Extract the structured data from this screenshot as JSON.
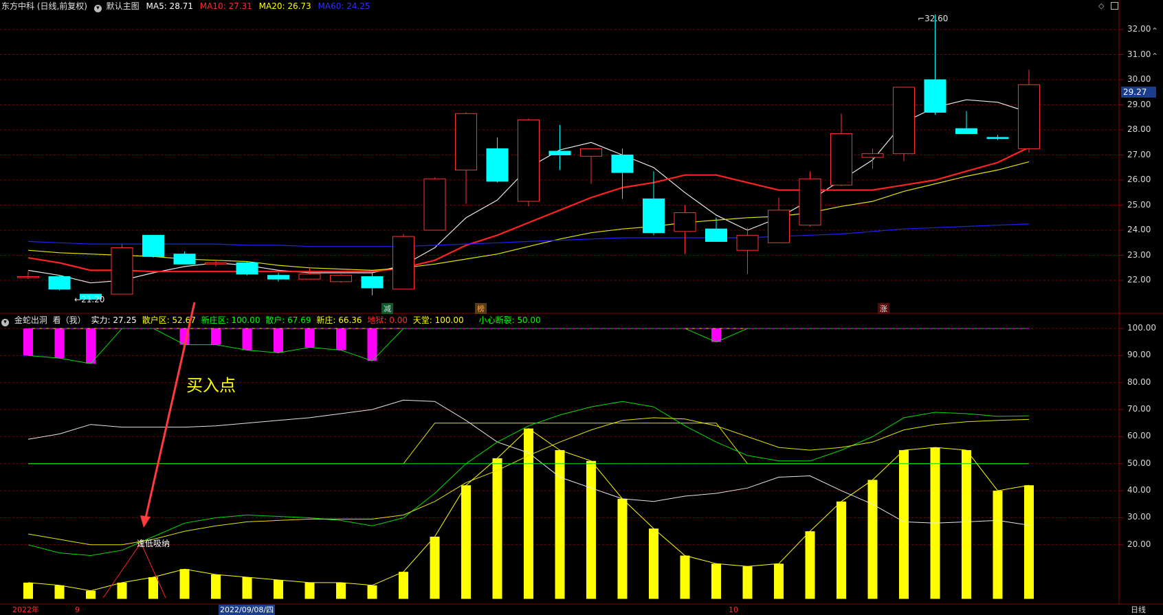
{
  "window": {
    "symbol_title": "东方中科 (日线,前复权)",
    "main_chart_label": "默认主图",
    "ma": [
      {
        "label": "MA5: 28.71",
        "color": "#ffffff"
      },
      {
        "label": "MA10: 27.31",
        "color": "#ff2b2b"
      },
      {
        "label": "MA20: 26.73",
        "color": "#ffff00"
      },
      {
        "label": "MA60: 24.25",
        "color": "#3030ff"
      }
    ]
  },
  "price_axis": {
    "labels": [
      "32.00",
      "31.00",
      "30.00",
      "29.00",
      "28.00",
      "27.00",
      "26.00",
      "25.00",
      "24.00",
      "23.00",
      "22.00"
    ],
    "current_price": "29.27",
    "high_label": "32.60",
    "low_label": "21.20"
  },
  "indicator": {
    "name": "金蛇出洞",
    "view_label": "看（我）",
    "legend": [
      {
        "label": "实力: 27.25",
        "color": "#ffffff"
      },
      {
        "label": "散户区: 52.67",
        "color": "#ffff00"
      },
      {
        "label": "新庄区: 100.00",
        "color": "#00ff00"
      },
      {
        "label": "散户: 67.69",
        "color": "#00ff00"
      },
      {
        "label": "新庄: 66.36",
        "color": "#ffff00"
      },
      {
        "label": "地狱: 0.00",
        "color": "#ff3030"
      },
      {
        "label": "天堂: 100.00",
        "color": "#ffff00"
      },
      {
        "label": "小心断裂: 50.00",
        "color": "#00ff00"
      }
    ],
    "axis_labels": [
      "100.00",
      "90.00",
      "80.00",
      "70.00",
      "60.00",
      "50.00",
      "40.00",
      "30.00",
      "20.00"
    ],
    "annotation_buy": "买入点",
    "annotation_low": "逢低吸纳"
  },
  "markers": {
    "jian": "减",
    "bang": "榜",
    "zhang": "涨"
  },
  "time_axis": {
    "year_label": "2022年",
    "month_9": "9",
    "cursor_date": "2022/09/08/四",
    "month_10": "10",
    "period_button": "日线"
  },
  "chart_data": [
    {
      "type": "candlestick",
      "title": "东方中科 (日线,前复权)",
      "ylim": [
        21,
        32.8
      ],
      "grid": true,
      "candles": [
        {
          "o": 22.15,
          "h": 22.35,
          "l": 22.05,
          "c": 22.15
        },
        {
          "o": 22.15,
          "h": 22.2,
          "l": 21.6,
          "c": 21.65
        },
        {
          "o": 21.45,
          "h": 21.45,
          "l": 21.2,
          "c": 21.25
        },
        {
          "o": 21.45,
          "h": 23.45,
          "l": 21.45,
          "c": 23.3
        },
        {
          "o": 23.8,
          "h": 23.8,
          "l": 22.9,
          "c": 22.95
        },
        {
          "o": 23.05,
          "h": 23.15,
          "l": 22.65,
          "c": 22.65
        },
        {
          "o": 22.65,
          "h": 22.8,
          "l": 22.55,
          "c": 22.7
        },
        {
          "o": 22.7,
          "h": 22.75,
          "l": 22.2,
          "c": 22.25
        },
        {
          "o": 22.2,
          "h": 22.3,
          "l": 21.95,
          "c": 22.05
        },
        {
          "o": 22.05,
          "h": 22.5,
          "l": 22.05,
          "c": 22.25
        },
        {
          "o": 21.95,
          "h": 22.25,
          "l": 21.9,
          "c": 22.2
        },
        {
          "o": 22.15,
          "h": 22.3,
          "l": 21.4,
          "c": 21.7
        },
        {
          "o": 21.65,
          "h": 23.85,
          "l": 21.65,
          "c": 23.75
        },
        {
          "o": 24.0,
          "h": 26.1,
          "l": 24.0,
          "c": 26.05
        },
        {
          "o": 26.4,
          "h": 28.7,
          "l": 25.05,
          "c": 28.65
        },
        {
          "o": 27.25,
          "h": 27.7,
          "l": 25.9,
          "c": 25.95
        },
        {
          "o": 25.15,
          "h": 28.45,
          "l": 24.95,
          "c": 28.4
        },
        {
          "o": 27.15,
          "h": 28.2,
          "l": 26.4,
          "c": 27.0
        },
        {
          "o": 26.95,
          "h": 27.25,
          "l": 25.85,
          "c": 27.25
        },
        {
          "o": 27.0,
          "h": 27.25,
          "l": 25.25,
          "c": 26.3
        },
        {
          "o": 25.25,
          "h": 26.35,
          "l": 23.8,
          "c": 23.9
        },
        {
          "o": 23.95,
          "h": 25.0,
          "l": 23.05,
          "c": 24.7
        },
        {
          "o": 24.05,
          "h": 24.5,
          "l": 23.55,
          "c": 23.55
        },
        {
          "o": 23.2,
          "h": 24.1,
          "l": 22.25,
          "c": 23.8
        },
        {
          "o": 23.5,
          "h": 25.3,
          "l": 23.5,
          "c": 24.8
        },
        {
          "o": 24.2,
          "h": 26.35,
          "l": 24.15,
          "c": 26.05
        },
        {
          "o": 25.8,
          "h": 28.65,
          "l": 25.75,
          "c": 27.85
        },
        {
          "o": 26.9,
          "h": 27.25,
          "l": 26.45,
          "c": 27.05
        },
        {
          "o": 27.05,
          "h": 29.7,
          "l": 26.75,
          "c": 29.7
        },
        {
          "o": 30.0,
          "h": 32.6,
          "l": 28.6,
          "c": 28.7
        },
        {
          "o": 28.05,
          "h": 28.75,
          "l": 27.85,
          "c": 27.85
        },
        {
          "o": 27.7,
          "h": 27.8,
          "l": 27.6,
          "c": 27.65
        },
        {
          "o": 27.25,
          "h": 30.4,
          "l": 27.1,
          "c": 29.8
        }
      ],
      "series": [
        {
          "name": "MA5",
          "color": "#e8e8e8",
          "values": [
            22.4,
            22.2,
            21.9,
            22.0,
            22.3,
            22.55,
            22.7,
            22.6,
            22.4,
            22.3,
            22.3,
            22.3,
            22.6,
            23.3,
            24.5,
            25.2,
            26.5,
            27.2,
            27.5,
            27.0,
            26.5,
            25.5,
            24.6,
            24.0,
            24.5,
            25.2,
            26.0,
            26.8,
            28.3,
            28.9,
            29.2,
            29.1,
            28.7
          ]
        },
        {
          "name": "MA10",
          "color": "#ff2222",
          "values": [
            22.9,
            22.7,
            22.4,
            22.4,
            22.35,
            22.35,
            22.35,
            22.35,
            22.35,
            22.35,
            22.35,
            22.35,
            22.5,
            22.8,
            23.4,
            23.8,
            24.3,
            24.8,
            25.3,
            25.7,
            25.9,
            26.2,
            26.2,
            25.9,
            25.6,
            25.6,
            25.6,
            25.6,
            25.8,
            26.0,
            26.35,
            26.7,
            27.3
          ]
        },
        {
          "name": "MA20",
          "color": "#e6e600",
          "values": [
            23.2,
            23.1,
            23.05,
            23.0,
            22.95,
            22.85,
            22.8,
            22.75,
            22.6,
            22.5,
            22.45,
            22.4,
            22.5,
            22.65,
            22.85,
            23.05,
            23.35,
            23.65,
            23.9,
            24.05,
            24.15,
            24.3,
            24.4,
            24.5,
            24.55,
            24.7,
            24.95,
            25.15,
            25.55,
            25.85,
            26.15,
            26.4,
            26.73
          ]
        },
        {
          "name": "MA60",
          "color": "#2020ff",
          "values": [
            23.55,
            23.5,
            23.45,
            23.45,
            23.45,
            23.45,
            23.45,
            23.4,
            23.4,
            23.35,
            23.35,
            23.35,
            23.35,
            23.4,
            23.45,
            23.5,
            23.55,
            23.6,
            23.65,
            23.7,
            23.7,
            23.7,
            23.7,
            23.7,
            23.75,
            23.8,
            23.85,
            23.95,
            24.05,
            24.1,
            24.15,
            24.2,
            24.25
          ]
        }
      ]
    },
    {
      "type": "bar",
      "title": "金蛇出洞",
      "ylim": [
        0,
        105
      ],
      "grid": true,
      "bars_yellow": [
        6,
        5,
        3,
        6,
        8,
        11,
        9,
        8,
        7,
        6,
        6,
        5,
        10,
        23,
        42,
        52,
        63,
        55,
        51,
        37,
        26,
        16,
        13,
        12,
        13,
        25,
        36,
        44,
        55,
        56,
        55,
        40,
        42
      ],
      "bars_magenta": [
        90,
        89,
        87,
        100,
        100,
        94,
        94,
        92,
        91,
        93,
        92,
        88,
        100,
        100,
        100,
        100,
        100,
        100,
        100,
        100,
        100,
        100,
        95,
        100,
        100,
        100,
        100,
        100,
        100,
        100,
        100,
        100,
        100
      ],
      "series": [
        {
          "name": "实力",
          "color": "#e8e8e8",
          "values": [
            59,
            61,
            64.5,
            63.5,
            63.5,
            63.5,
            64,
            65,
            66,
            67,
            68.5,
            70,
            73.5,
            73,
            66,
            58,
            54,
            45,
            41,
            37,
            36,
            38,
            39,
            41,
            45,
            45.5,
            40,
            35,
            28.5,
            28,
            28.5,
            29,
            27.25
          ]
        },
        {
          "name": "散户区",
          "color": "#e6e600",
          "values": [
            50,
            50,
            50,
            50,
            50,
            50,
            50,
            50,
            50,
            50,
            50,
            50,
            50,
            65,
            65,
            65,
            65,
            65,
            65,
            65,
            65,
            65,
            65,
            50,
            50,
            50,
            50,
            50,
            50,
            50,
            50,
            50,
            50
          ]
        },
        {
          "name": "散户",
          "color": "#00e000",
          "values": [
            20,
            17,
            16,
            18,
            23,
            28,
            30,
            31,
            30.5,
            30,
            29,
            27,
            30,
            39,
            50,
            58,
            64,
            68,
            71,
            73,
            71,
            64,
            58,
            53,
            51,
            51,
            55,
            60,
            67,
            69,
            68.5,
            67.5,
            67.69
          ]
        },
        {
          "name": "新庄",
          "color": "#e6e600",
          "values": [
            24,
            22,
            20,
            20,
            22,
            25,
            27,
            28.5,
            29,
            29.5,
            29.5,
            29.5,
            31,
            36,
            43,
            47.5,
            53,
            58,
            62.5,
            66,
            67,
            66.5,
            64,
            60,
            56,
            55,
            56,
            58,
            62.5,
            64.5,
            65.5,
            66,
            66.36
          ]
        },
        {
          "name": "地狱",
          "color": "#ff2020",
          "values": [
            0,
            0,
            0,
            0,
            0,
            0,
            0,
            0,
            0,
            0,
            0,
            0,
            0,
            0,
            0,
            0,
            0,
            0,
            0,
            0,
            0,
            0,
            0,
            0,
            0,
            0,
            0,
            0,
            0,
            0,
            0,
            0,
            0
          ]
        },
        {
          "name": "天堂",
          "color": "#e6e600",
          "values": [
            100,
            100,
            100,
            100,
            100,
            100,
            100,
            100,
            100,
            100,
            100,
            100,
            100,
            100,
            100,
            100,
            100,
            100,
            100,
            100,
            100,
            100,
            100,
            100,
            100,
            100,
            100,
            100,
            100,
            100,
            100,
            100,
            100
          ]
        },
        {
          "name": "小心断裂",
          "color": "#00e000",
          "values": [
            50,
            50,
            50,
            50,
            50,
            50,
            50,
            50,
            50,
            50,
            50,
            50,
            50,
            50,
            50,
            50,
            50,
            50,
            50,
            50,
            50,
            50,
            50,
            50,
            50,
            50,
            50,
            50,
            50,
            50,
            50,
            50,
            50
          ]
        }
      ]
    }
  ]
}
